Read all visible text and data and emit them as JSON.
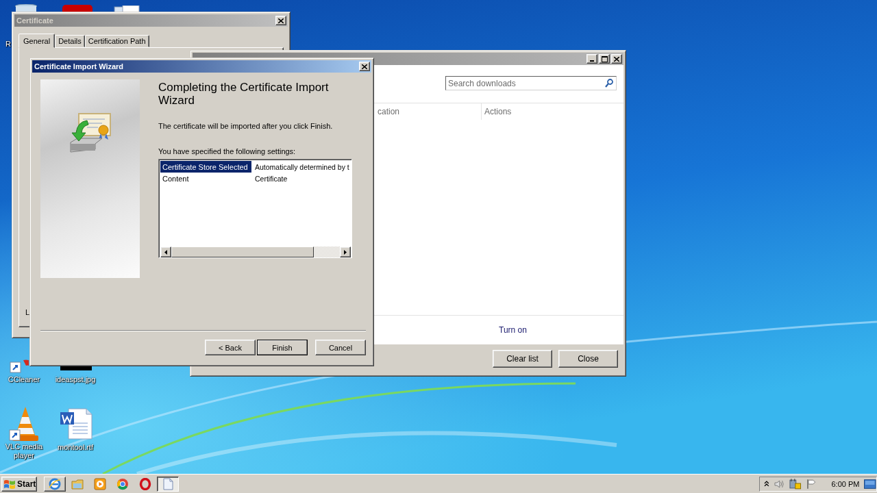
{
  "desktop": {
    "partial_label": "R",
    "icons": [
      {
        "kind": "ccleaner",
        "label": "CCleaner"
      },
      {
        "kind": "image",
        "label": "ideaspst.jpg"
      },
      {
        "kind": "vlc",
        "label": "VLC media player"
      },
      {
        "kind": "word",
        "label": "montool.rtf"
      }
    ]
  },
  "certificate_window": {
    "title": "Certificate",
    "tabs": [
      {
        "label": "General",
        "selected": true
      },
      {
        "label": "Details",
        "selected": false
      },
      {
        "label": "Certification Path",
        "selected": false
      }
    ],
    "partial_label": "L"
  },
  "downloads_window": {
    "search": {
      "placeholder": "Search downloads"
    },
    "columns": [
      "cation",
      "Actions"
    ],
    "link": "Turn on",
    "buttons": [
      "Clear list",
      "Close"
    ]
  },
  "wizard": {
    "title": "Certificate Import Wizard",
    "heading": "Completing the Certificate Import Wizard",
    "message": "The certificate will be imported after you click Finish.",
    "settings_label": "You have specified the following settings:",
    "settings": [
      {
        "name": "Certificate Store Selected",
        "value": "Automatically determined by t",
        "selected": true
      },
      {
        "name": "Content",
        "value": "Certificate",
        "selected": false
      }
    ],
    "buttons": [
      {
        "label": "< Back",
        "default": false
      },
      {
        "label": "Finish",
        "default": true
      },
      {
        "label": "Cancel",
        "default": false
      }
    ]
  },
  "taskbar": {
    "start": "Start",
    "apps": [
      {
        "kind": "ie",
        "open": true,
        "active": false
      },
      {
        "kind": "folder",
        "open": false,
        "active": false
      },
      {
        "kind": "media",
        "open": false,
        "active": false
      },
      {
        "kind": "chrome",
        "open": false,
        "active": false
      },
      {
        "kind": "opera",
        "open": false,
        "active": false
      },
      {
        "kind": "document",
        "open": true,
        "active": true
      }
    ],
    "clock": "6:00 PM"
  }
}
